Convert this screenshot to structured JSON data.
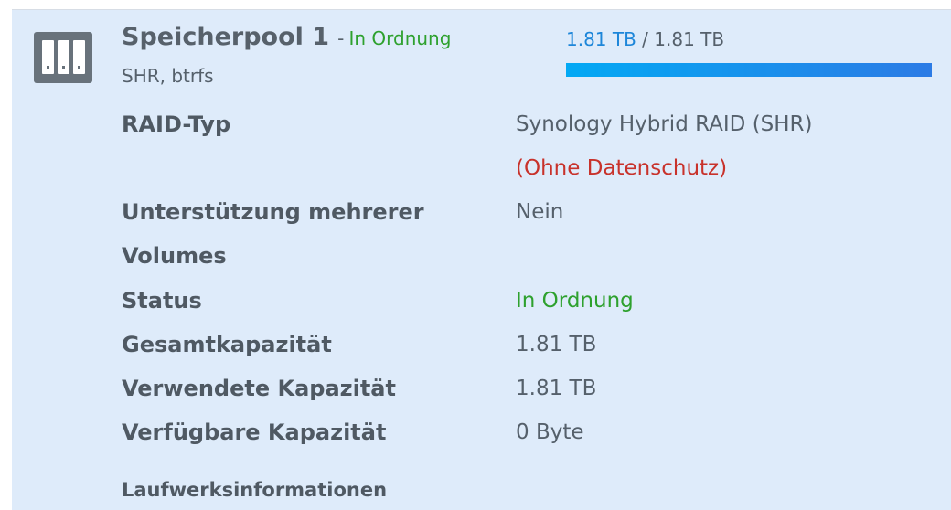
{
  "pool": {
    "name": "Speicherpool 1",
    "separator": "-",
    "status": "In Ordnung",
    "subtitle": "SHR, btrfs",
    "icon": "storage-pool-icon",
    "capacity": {
      "used": "1.81 TB",
      "separator": " / ",
      "total": "1.81 TB",
      "used_fraction": 1.0
    }
  },
  "details": {
    "raid_type": {
      "label": "RAID-Typ",
      "value": "Synology Hybrid RAID (SHR)",
      "note": "(Ohne Datenschutz)"
    },
    "multi_volume": {
      "label_line1": "Unterstützung mehrerer",
      "label_line2": "Volumes",
      "value": "Nein"
    },
    "status": {
      "label": "Status",
      "value": "In Ordnung"
    },
    "total_capacity": {
      "label": "Gesamtkapazität",
      "value": "1.81 TB"
    },
    "used_capacity": {
      "label": "Verwendete Kapazität",
      "value": "1.81 TB"
    },
    "available_capacity": {
      "label": "Verfügbare Kapazität",
      "value": "0 Byte"
    }
  },
  "drive_info": {
    "title": "Laufwerksinformationen"
  },
  "colors": {
    "panel_bg": "#deebfa",
    "ok": "#2ea12e",
    "warning": "#c8322b",
    "accent": "#1d86d9"
  }
}
